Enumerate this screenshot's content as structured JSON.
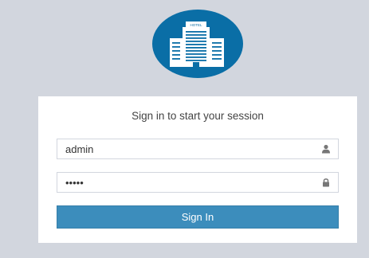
{
  "logo": {
    "sign_text": "HOTEL",
    "icon": "hotel-building-icon",
    "color": "#0a6ea6"
  },
  "login": {
    "title": "Sign in to start your session",
    "username": {
      "value": "admin",
      "icon": "user-icon"
    },
    "password": {
      "value": "•••••",
      "icon": "lock-icon"
    },
    "submit_label": "Sign In"
  },
  "colors": {
    "background": "#d2d6de",
    "button": "#3c8dbc"
  }
}
